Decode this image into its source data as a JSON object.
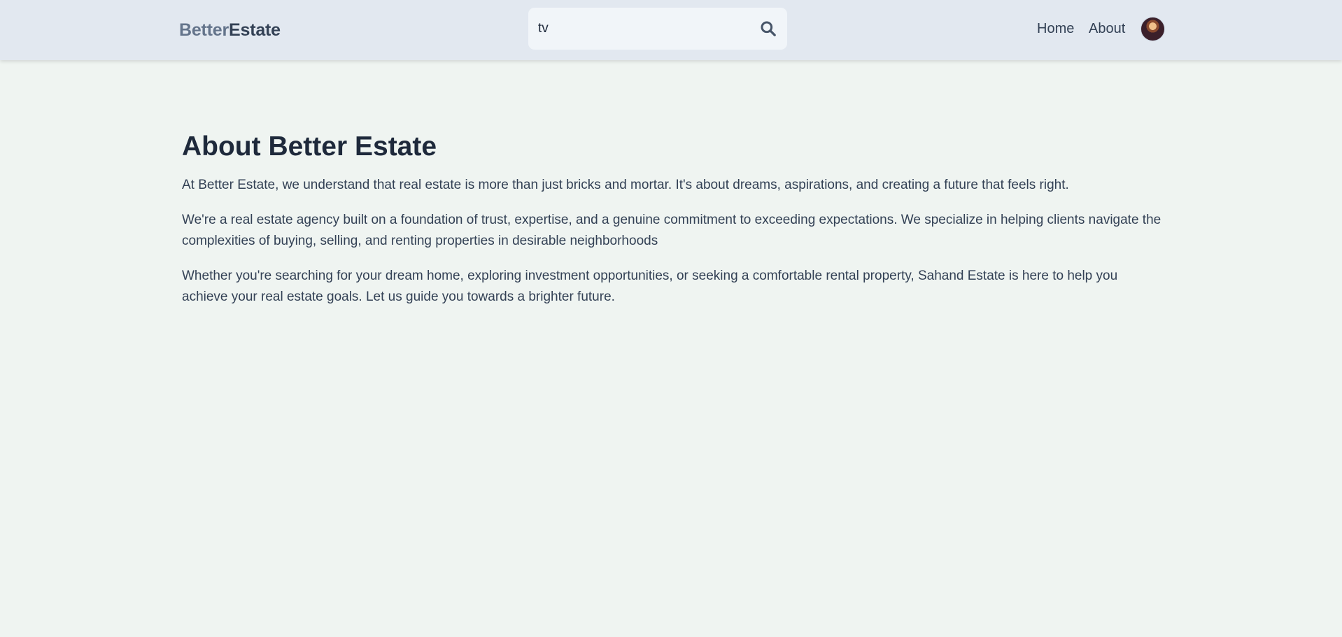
{
  "header": {
    "logo_part1": "Better",
    "logo_part2": "Estate",
    "search": {
      "value": "tv",
      "placeholder": "Search...",
      "icon": "search-icon"
    },
    "nav": {
      "home_label": "Home",
      "about_label": "About"
    },
    "avatar_icon": "user-avatar"
  },
  "main": {
    "title": "About Better Estate",
    "paragraphs": [
      "At Better Estate, we understand that real estate is more than just bricks and mortar. It's about dreams, aspirations, and creating a future that feels right.",
      "We're a real estate agency built on a foundation of trust, expertise, and a genuine commitment to exceeding expectations. We specialize in helping clients navigate the complexities of buying, selling, and renting properties in desirable neighborhoods",
      "Whether you're searching for your dream home, exploring investment opportunities, or seeking a comfortable rental property, Sahand Estate is here to help you achieve your real estate goals. Let us guide you towards a brighter future."
    ]
  },
  "colors": {
    "header_bg": "#e2e8f0",
    "page_bg": "#eff4f1",
    "title": "#1e293b",
    "text": "#334155",
    "logo_light": "#64748b",
    "logo_dark": "#334155"
  }
}
